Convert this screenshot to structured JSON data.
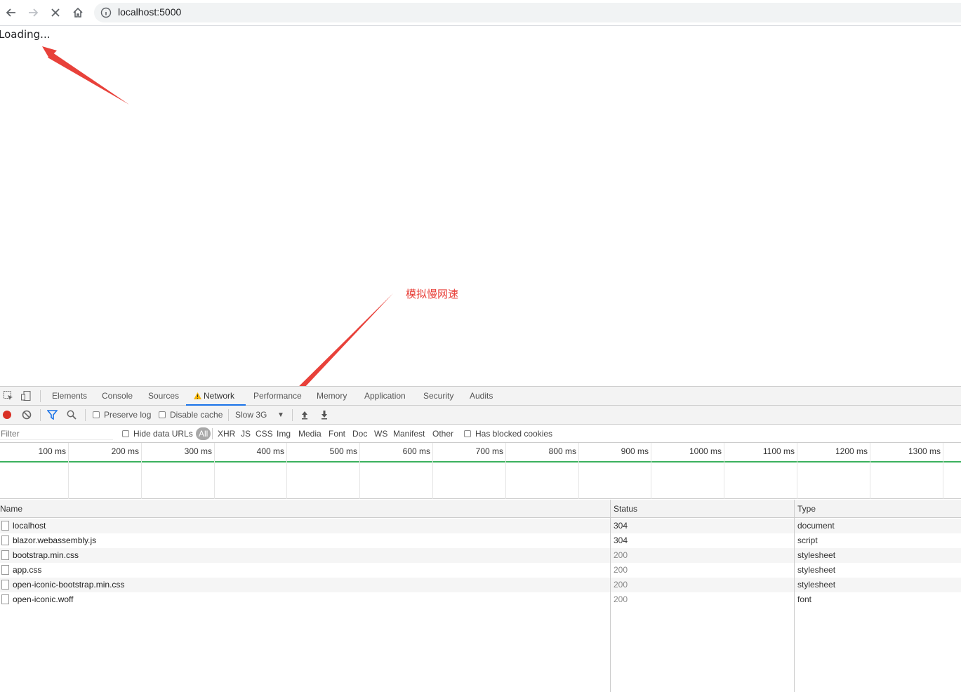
{
  "browser": {
    "url": "localhost:5000",
    "back_icon": "arrow-left-icon",
    "forward_icon": "arrow-right-icon",
    "stop_icon": "close-icon",
    "home_icon": "home-icon",
    "info_icon": "info-icon"
  },
  "page": {
    "loading_text": "Loading..."
  },
  "annotation": {
    "label": "模拟慢网速",
    "color": "#e8413a"
  },
  "devtools": {
    "tabs": [
      "Elements",
      "Console",
      "Sources",
      "Network",
      "Performance",
      "Memory",
      "Application",
      "Security",
      "Audits"
    ],
    "active_tab": "Network",
    "toolbar": {
      "preserve_log": "Preserve log",
      "disable_cache": "Disable cache",
      "throttling": "Slow 3G"
    },
    "filter": {
      "placeholder": "Filter",
      "hide_data_urls": "Hide data URLs",
      "types": [
        "All",
        "XHR",
        "JS",
        "CSS",
        "Img",
        "Media",
        "Font",
        "Doc",
        "WS",
        "Manifest",
        "Other"
      ],
      "has_blocked_cookies": "Has blocked cookies"
    },
    "timeline_ticks": [
      "100 ms",
      "200 ms",
      "300 ms",
      "400 ms",
      "500 ms",
      "600 ms",
      "700 ms",
      "800 ms",
      "900 ms",
      "1000 ms",
      "1100 ms",
      "1200 ms",
      "1300 ms"
    ],
    "columns": {
      "name": "Name",
      "status": "Status",
      "type": "Type"
    },
    "requests": [
      {
        "name": "localhost",
        "status": "304",
        "type": "document"
      },
      {
        "name": "blazor.webassembly.js",
        "status": "304",
        "type": "script"
      },
      {
        "name": "bootstrap.min.css",
        "status": "200",
        "type": "stylesheet"
      },
      {
        "name": "app.css",
        "status": "200",
        "type": "stylesheet"
      },
      {
        "name": "open-iconic-bootstrap.min.css",
        "status": "200",
        "type": "stylesheet"
      },
      {
        "name": "open-iconic.woff",
        "status": "200",
        "type": "font"
      }
    ],
    "colors": {
      "record": "#d93025",
      "accent": "#1a73e8",
      "timeline": "#3bb15d",
      "warning": "#f4b400"
    }
  }
}
